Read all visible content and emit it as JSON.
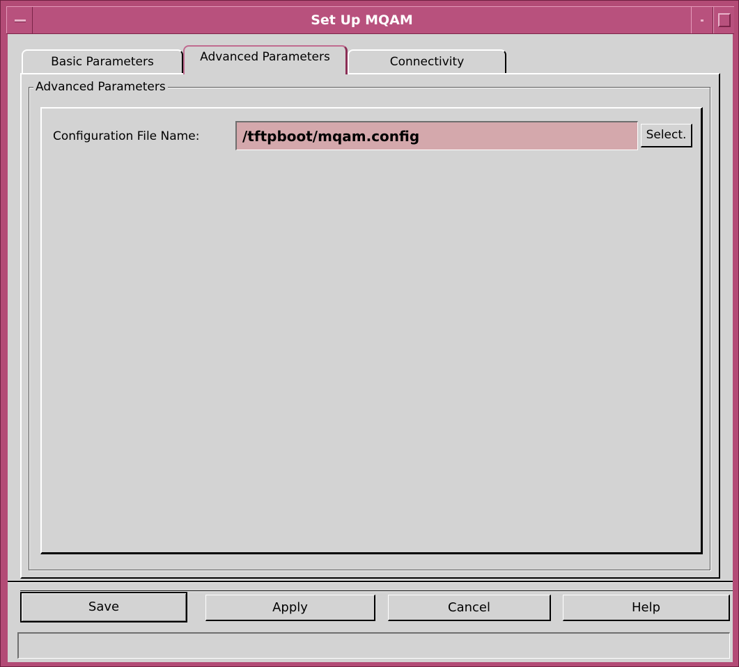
{
  "window": {
    "title": "Set Up MQAM"
  },
  "tabs": [
    {
      "label": "Basic Parameters",
      "selected": false
    },
    {
      "label": "Advanced Parameters",
      "selected": true
    },
    {
      "label": "Connectivity",
      "selected": false
    }
  ],
  "advanced": {
    "group_title": "Advanced Parameters",
    "config_label": "Configuration File Name:",
    "config_value": "/tftpboot/mqam.config",
    "select_label": "Select."
  },
  "buttons": {
    "save": "Save",
    "apply": "Apply",
    "cancel": "Cancel",
    "help": "Help"
  },
  "status": {
    "text": ""
  },
  "colors": {
    "title_bar": "#b8517d",
    "panel_bg": "#d3d3d3",
    "input_bg": "#d4a8ac",
    "selected_tab_border": "#c06a8f"
  },
  "icons": {
    "window_menu": "window-menu-icon",
    "minimize": "minimize-icon",
    "maximize": "maximize-icon"
  }
}
